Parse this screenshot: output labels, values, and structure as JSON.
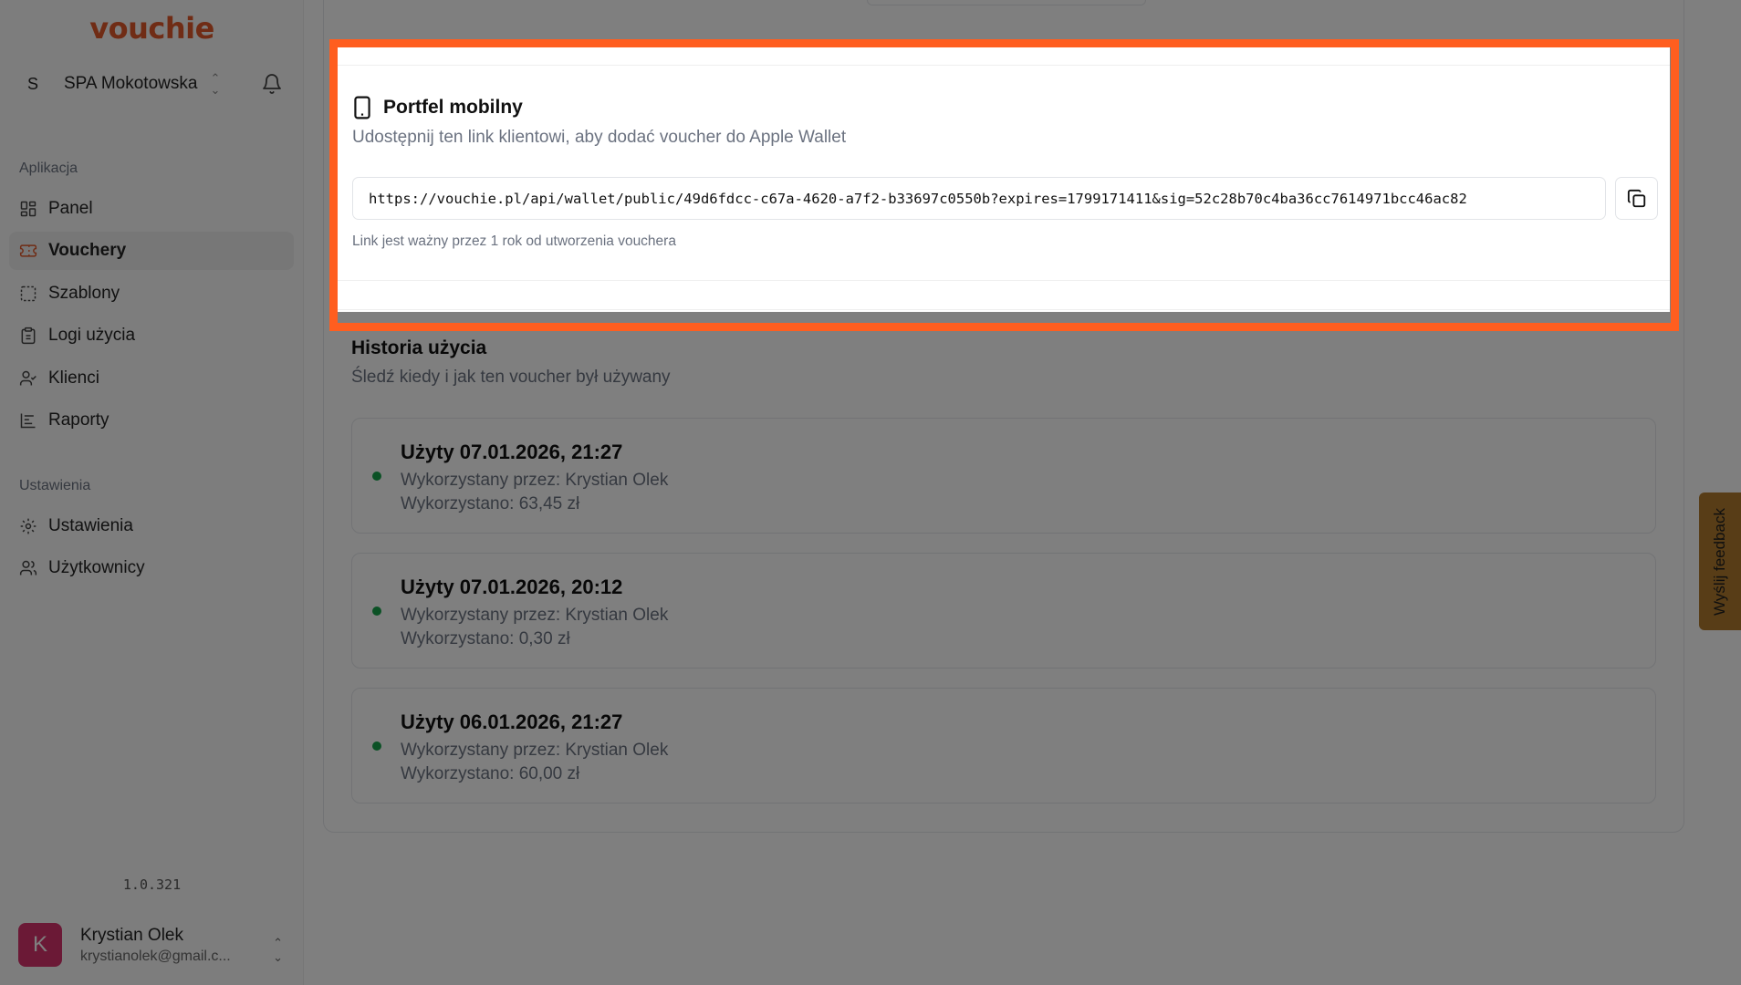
{
  "brand": {
    "logo": "vouchie"
  },
  "org": {
    "initial": "S",
    "name": "SPA Mokotowska"
  },
  "sidebar": {
    "section_app": "Aplikacja",
    "section_settings": "Ustawienia",
    "items": [
      {
        "label": "Panel",
        "icon": "dashboard-icon"
      },
      {
        "label": "Vouchery",
        "icon": "ticket-icon",
        "active": true
      },
      {
        "label": "Szablony",
        "icon": "template-icon"
      },
      {
        "label": "Logi użycia",
        "icon": "clipboard-icon"
      },
      {
        "label": "Klienci",
        "icon": "user-check-icon"
      },
      {
        "label": "Raporty",
        "icon": "bar-chart-icon"
      },
      {
        "label": "Ustawienia",
        "icon": "gear-icon"
      },
      {
        "label": "Użytkownicy",
        "icon": "users-icon"
      }
    ],
    "version": "1.0.321"
  },
  "user": {
    "initial": "K",
    "name": "Krystian Olek",
    "email": "krystianolek@gmail.c..."
  },
  "wallet": {
    "title": "Portfel mobilny",
    "description": "Udostępnij ten link klientowi, aby dodać voucher do Apple Wallet",
    "url": "https://vouchie.pl/api/wallet/public/49d6fdcc-c67a-4620-a7f2-b33697c0550b?expires=1799171411&sig=52c28b70c4ba36cc7614971bcc46ac82",
    "note": "Link jest ważny przez 1 rok od utworzenia vouchera"
  },
  "history": {
    "title": "Historia użycia",
    "description": "Śledź kiedy i jak ten voucher był używany",
    "entries": [
      {
        "title": "Użyty 07.01.2026, 21:27",
        "by": "Wykorzystany przez: Krystian Olek",
        "amount": "Wykorzystano: 63,45 zł"
      },
      {
        "title": "Użyty 07.01.2026, 20:12",
        "by": "Wykorzystany przez: Krystian Olek",
        "amount": "Wykorzystano: 0,30 zł"
      },
      {
        "title": "Użyty 06.01.2026, 21:27",
        "by": "Wykorzystany przez: Krystian Olek",
        "amount": "Wykorzystano: 60,00 zł"
      }
    ]
  },
  "feedback": {
    "label": "Wyślij feedback"
  },
  "colors": {
    "brand": "#e0592a",
    "highlight": "#ff5e1f",
    "status_dot": "#16a34a",
    "feedback_bg": "#b07a2e"
  }
}
